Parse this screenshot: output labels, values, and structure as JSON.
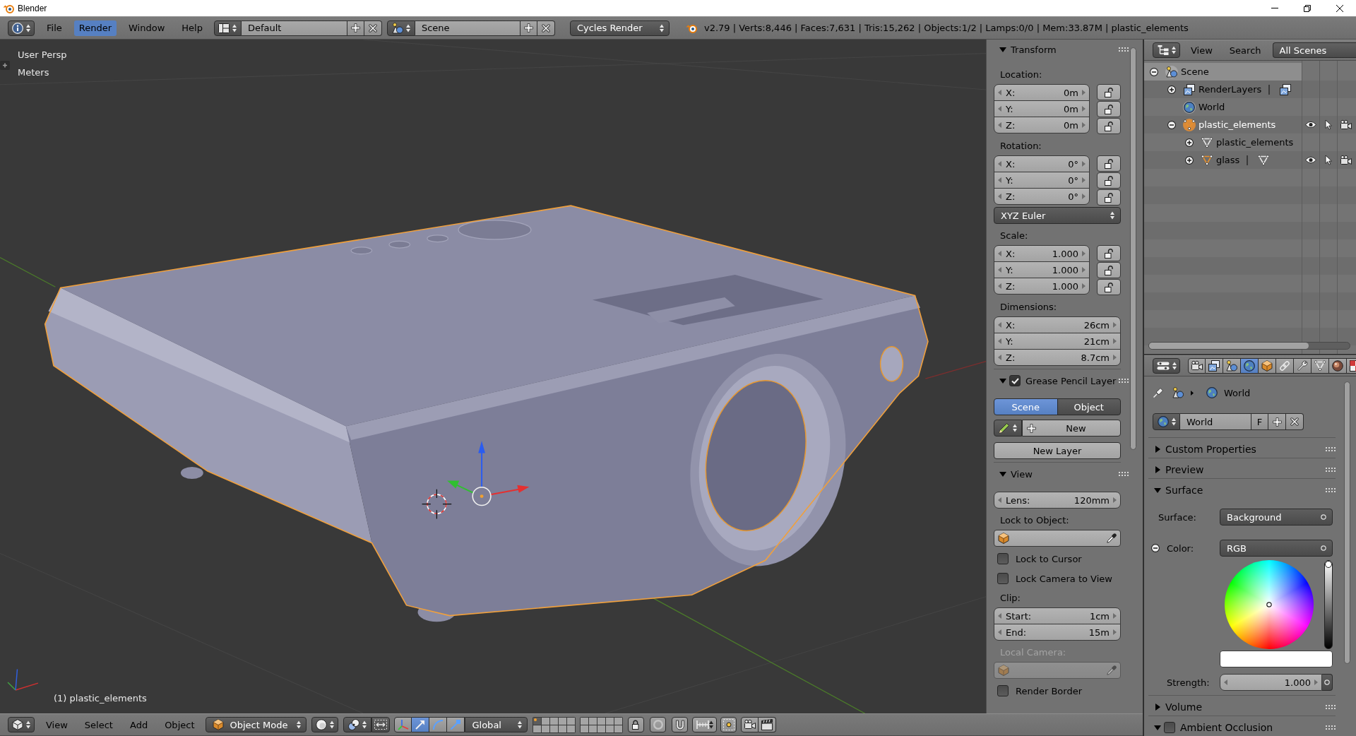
{
  "window": {
    "title": "Blender"
  },
  "info_header": {
    "menus": [
      {
        "label": "File",
        "selected": false
      },
      {
        "label": "Render",
        "selected": true
      },
      {
        "label": "Window",
        "selected": false
      },
      {
        "label": "Help",
        "selected": false
      }
    ],
    "screen_layout": "Default",
    "scene": "Scene",
    "render_engine": "Cycles Render",
    "stats": "v2.79 | Verts:8,446 | Faces:7,631 | Tris:15,262 | Objects:1/2 | Lamps:0/0 | Mem:33.87M | plastic_elements"
  },
  "viewport": {
    "view_name": "User Persp",
    "units": "Meters",
    "active_object": "(1) plastic_elements"
  },
  "sidebar": {
    "panels": [
      {
        "title": "Transform",
        "expanded": true,
        "rows": [
          {
            "kind": "heading",
            "label": "Location:",
            "disabled": false
          },
          {
            "kind": "vector",
            "fields": [
              {
                "label": "X:",
                "value": "0m",
                "locked": false
              },
              {
                "label": "Y:",
                "value": "0m",
                "locked": false
              },
              {
                "label": "Z:",
                "value": "0m",
                "locked": false
              }
            ]
          },
          {
            "kind": "heading",
            "label": "Rotation:",
            "disabled": false
          },
          {
            "kind": "vector",
            "fields": [
              {
                "label": "X:",
                "value": "0°",
                "locked": false
              },
              {
                "label": "Y:",
                "value": "0°",
                "locked": false
              },
              {
                "label": "Z:",
                "value": "0°",
                "locked": false
              }
            ]
          },
          {
            "kind": "enum",
            "value": "XYZ Euler"
          },
          {
            "kind": "heading",
            "label": "Scale:",
            "disabled": false
          },
          {
            "kind": "vector",
            "fields": [
              {
                "label": "X:",
                "value": "1.000",
                "locked": false
              },
              {
                "label": "Y:",
                "value": "1.000",
                "locked": false
              },
              {
                "label": "Z:",
                "value": "1.000",
                "locked": false
              }
            ]
          },
          {
            "kind": "heading",
            "label": "Dimensions:",
            "disabled": false
          },
          {
            "kind": "vector",
            "fields": [
              {
                "label": "X:",
                "value": "26cm"
              },
              {
                "label": "Y:",
                "value": "21cm"
              },
              {
                "label": "Z:",
                "value": "8.7cm"
              }
            ]
          }
        ]
      },
      {
        "title": "Grease Pencil Layer",
        "expanded": true,
        "enabled": true,
        "rows": [
          {
            "kind": "segmented",
            "options": [
              {
                "label": "Scene",
                "selected": true
              },
              {
                "label": "Object",
                "selected": false
              }
            ]
          },
          {
            "kind": "new_datablock",
            "label": "New"
          },
          {
            "kind": "button",
            "label": "New Layer"
          }
        ]
      },
      {
        "title": "View",
        "expanded": true,
        "rows": [
          {
            "kind": "vector",
            "fields": [
              {
                "label": "Lens:",
                "value": "120mm"
              }
            ]
          },
          {
            "kind": "heading",
            "label": "Lock to Object:",
            "disabled": false
          },
          {
            "kind": "object_field",
            "disabled": false
          },
          {
            "kind": "checkbox",
            "label": "Lock to Cursor",
            "checked": false
          },
          {
            "kind": "checkbox",
            "label": "Lock Camera to View",
            "checked": false
          },
          {
            "kind": "heading",
            "label": "Clip:",
            "disabled": false
          },
          {
            "kind": "vector",
            "fields": [
              {
                "label": "Start:",
                "value": "1cm"
              },
              {
                "label": "End:",
                "value": "15m"
              }
            ]
          },
          {
            "kind": "heading",
            "label": "Local Camera:",
            "disabled": true
          },
          {
            "kind": "object_field",
            "disabled": true
          },
          {
            "kind": "checkbox",
            "label": "Render Border",
            "checked": false
          }
        ]
      }
    ]
  },
  "outliner": {
    "menus": [
      "View",
      "Search"
    ],
    "display_mode": "All Scenes",
    "tree": [
      {
        "label": "Scene",
        "kind": "scene",
        "expanded": true,
        "selected": true,
        "active": true,
        "children": [
          {
            "label": "RenderLayers",
            "kind": "render_layers",
            "expanded": false,
            "selected": false,
            "active": false,
            "extra": {
              "kind": "render_layers"
            }
          },
          {
            "label": "World",
            "kind": "world",
            "selected": false,
            "active": true
          },
          {
            "label": "plastic_elements",
            "kind": "mesh_object",
            "expanded": true,
            "selected": false,
            "active": true,
            "visible": true,
            "selectable": true,
            "renderable": true,
            "children": [
              {
                "label": "plastic_elements",
                "kind": "mesh_data",
                "expanded": false,
                "selected": false,
                "active": false
              },
              {
                "label": "glass",
                "kind": "mesh_object",
                "expanded": false,
                "selected": false,
                "active": false,
                "visible": true,
                "selectable": true,
                "renderable": true,
                "extra": {
                  "kind": "mesh_data"
                }
              }
            ]
          }
        ]
      }
    ]
  },
  "properties": {
    "tabs": [
      {
        "kind": "render",
        "selected": false
      },
      {
        "kind": "render_layers",
        "selected": false
      },
      {
        "kind": "scene",
        "selected": false
      },
      {
        "kind": "world",
        "selected": true
      },
      {
        "kind": "object",
        "selected": false
      },
      {
        "kind": "constraints",
        "selected": false
      },
      {
        "kind": "modifiers",
        "selected": false
      },
      {
        "kind": "data",
        "selected": false
      },
      {
        "kind": "material",
        "selected": false
      },
      {
        "kind": "texture",
        "selected": false
      }
    ],
    "context_path": "World",
    "datablock": {
      "name": "World",
      "fake_user": "F"
    },
    "panels": [
      {
        "title": "Custom Properties",
        "expanded": false
      },
      {
        "title": "Preview",
        "expanded": false
      },
      {
        "title": "Surface",
        "expanded": true,
        "rows": [
          {
            "kind": "enum",
            "label": "Surface:",
            "value": "Background"
          },
          {
            "kind": "enum",
            "label": "Color:",
            "value": "RGB",
            "expanded": true
          },
          {
            "kind": "color_wheel",
            "level": 1
          },
          {
            "kind": "swatch",
            "color": "#ffffff"
          },
          {
            "kind": "number",
            "label": "Strength:",
            "value": "1.000"
          }
        ]
      },
      {
        "title": "Volume",
        "expanded": false
      },
      {
        "title": "Ambient Occlusion",
        "expanded": true,
        "enabled": false
      }
    ]
  },
  "view3d_header": {
    "menus": [
      "View",
      "Select",
      "Add",
      "Object"
    ],
    "mode": "Object Mode",
    "orientation": "Global",
    "manipulators": [
      {
        "kind": "translate",
        "selected": true
      },
      {
        "kind": "rotate",
        "selected": false
      },
      {
        "kind": "scale",
        "selected": false
      }
    ],
    "layers": [
      {
        "selected": true,
        "occupied": true
      },
      {
        "selected": false,
        "occupied": false
      },
      {
        "selected": false,
        "occupied": false
      },
      {
        "selected": false,
        "occupied": false
      },
      {
        "selected": false,
        "occupied": false
      },
      {
        "selected": false,
        "occupied": false
      },
      {
        "selected": false,
        "occupied": false
      },
      {
        "selected": false,
        "occupied": false
      },
      {
        "selected": false,
        "occupied": false
      },
      {
        "selected": false,
        "occupied": false
      },
      {
        "selected": false,
        "occupied": false
      },
      {
        "selected": false,
        "occupied": false
      },
      {
        "selected": false,
        "occupied": false
      },
      {
        "selected": false,
        "occupied": false
      },
      {
        "selected": false,
        "occupied": false
      },
      {
        "selected": false,
        "occupied": false
      },
      {
        "selected": false,
        "occupied": false
      },
      {
        "selected": false,
        "occupied": false
      },
      {
        "selected": false,
        "occupied": false
      },
      {
        "selected": false,
        "occupied": false
      }
    ]
  }
}
